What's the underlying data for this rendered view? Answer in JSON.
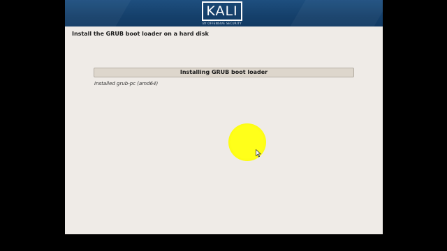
{
  "banner": {
    "logo_text": "KALI",
    "logo_tagline": "BY OFFENSIVE SECURITY"
  },
  "step": {
    "title": "Install the GRUB boot loader on a hard disk"
  },
  "progress": {
    "label": "Installing GRUB boot loader",
    "fraction": 0.0
  },
  "status": {
    "text": "Installed grub-pc (amd64)"
  },
  "colors": {
    "banner": "#1a4775",
    "installer_bg": "#efebe7",
    "progress_bg": "#ddd6cc",
    "cursor_highlight": "#ffff1a"
  },
  "icons": {
    "cursor": "mouse-pointer-icon"
  }
}
